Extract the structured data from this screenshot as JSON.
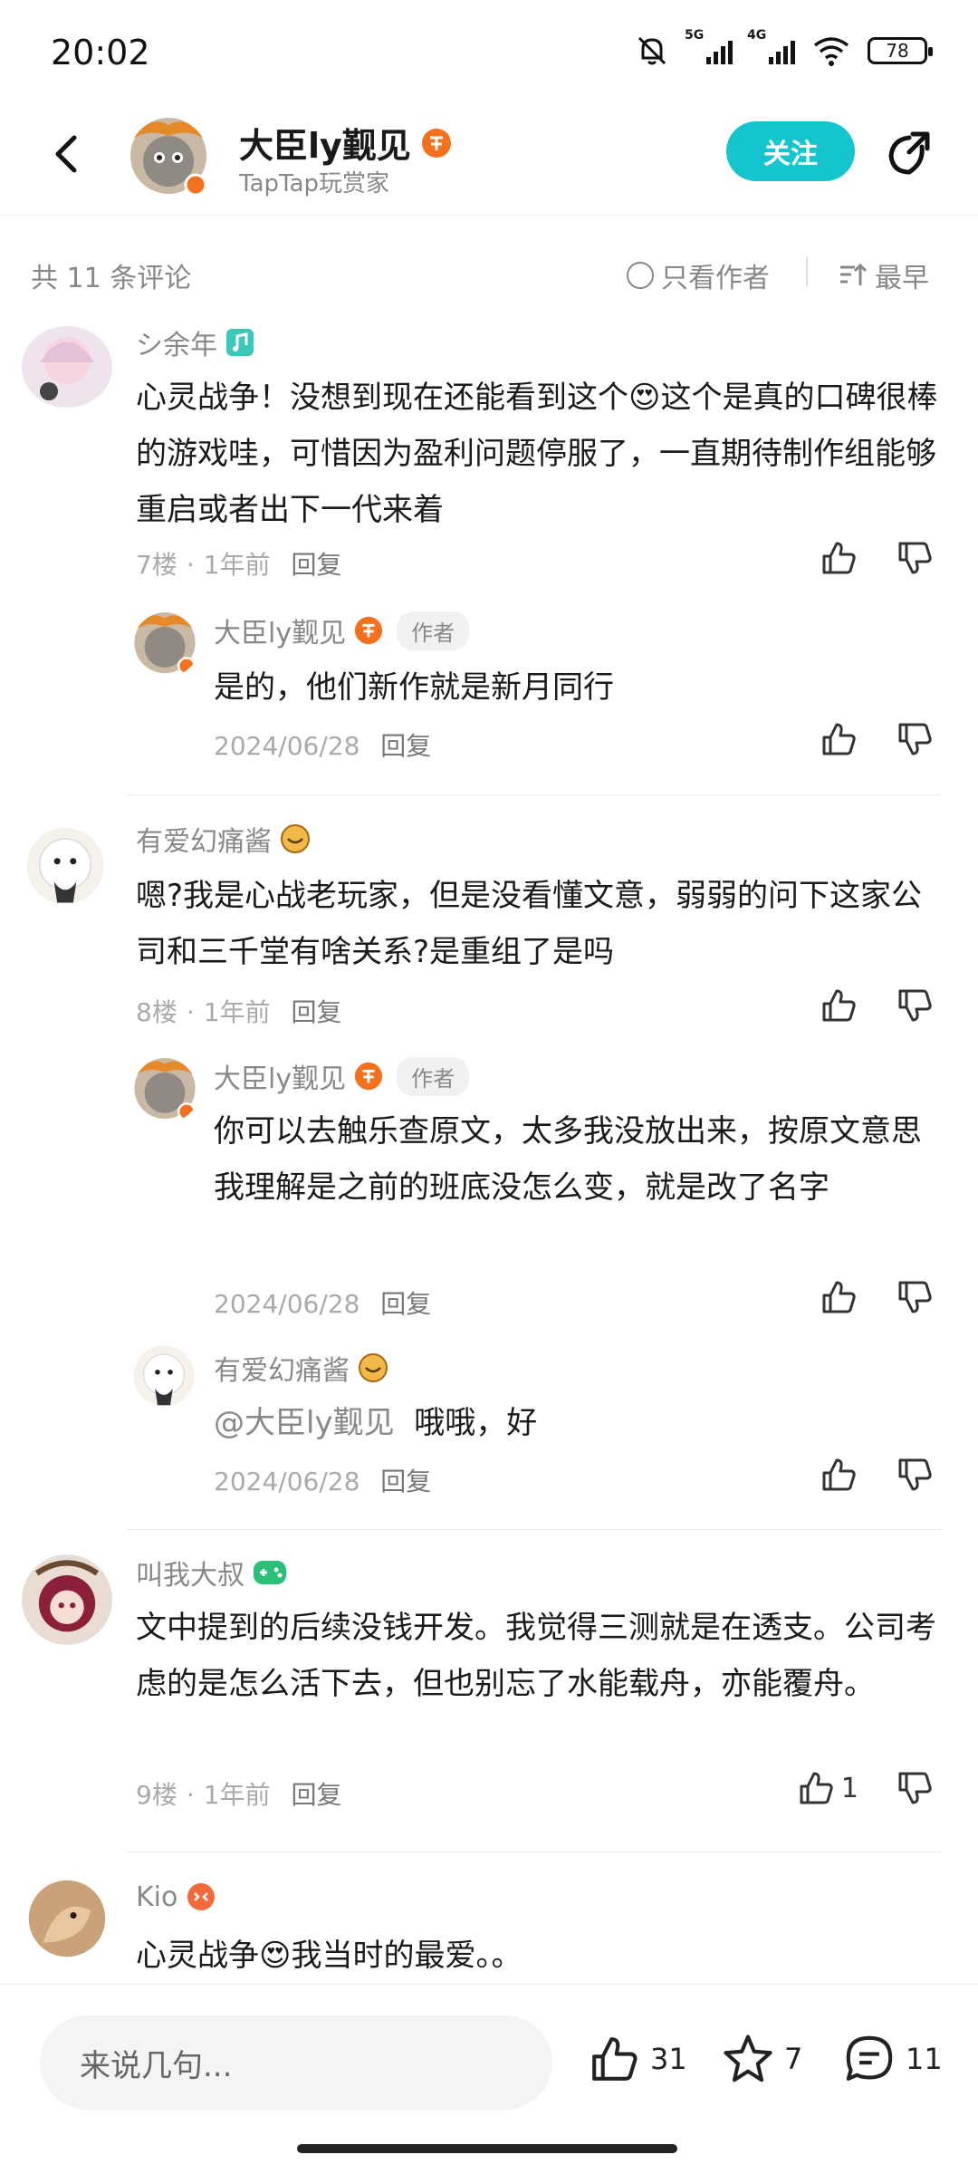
{
  "status_bar": {
    "time": "20:02",
    "net1": "5G",
    "net2": "4G",
    "battery": "78"
  },
  "header": {
    "user_name": "大臣ly觐见",
    "subtitle": "TapTap玩赏家",
    "follow_label": "关注"
  },
  "sort_bar": {
    "count": "共 11 条评论",
    "only_author": "只看作者",
    "sort_label": "最早"
  },
  "comments": [
    {
      "name": "シ余年",
      "text": "心灵战争！没想到现在还能看到这个😍这个是真的口碑很棒的游戏哇，可惜因为盈利问题停服了，一直期待制作组能够重启或者出下一代来着",
      "floor": "7楼",
      "time": "1年前",
      "reply": "回复",
      "like_count": ""
    },
    {
      "name": "有爱幻痛酱",
      "text": "嗯?我是心战老玩家，但是没看懂文意，弱弱的问下这家公司和三千堂有啥关系?是重组了是吗",
      "floor": "8楼",
      "time": "1年前",
      "reply": "回复",
      "like_count": ""
    },
    {
      "name": "叫我大叔",
      "text": "文中提到的后续没钱开发。我觉得三测就是在透支。公司考虑的是怎么活下去，但也别忘了水能载舟，亦能覆舟。",
      "floor": "9楼",
      "time": "1年前",
      "reply": "回复",
      "like_count": "1"
    },
    {
      "name": "Kio",
      "text": "心灵战争😍我当时的最爱。。"
    }
  ],
  "replies": [
    {
      "name": "大臣ly觐见",
      "tag": "作者",
      "text": "是的，他们新作就是新月同行",
      "date": "2024/06/28",
      "reply": "回复"
    },
    {
      "name": "大臣ly觐见",
      "tag": "作者",
      "text": "你可以去触乐查原文，太多我没放出来，按原文意思我理解是之前的班底没怎么变，就是改了名字",
      "date": "2024/06/28",
      "reply": "回复"
    },
    {
      "name": "有爱幻痛酱",
      "mention": "@大臣ly觐见",
      "text": "哦哦，好",
      "date": "2024/06/28",
      "reply": "回复"
    }
  ],
  "bottom_bar": {
    "input_placeholder": "来说几句...",
    "likes": "31",
    "favorites": "7",
    "comments": "11"
  },
  "colors": {
    "accent": "#15c5ce",
    "badge_orange": "#f2701e"
  },
  "icons": [
    "back-arrow-icon",
    "share-icon",
    "thumb-up-icon",
    "thumb-down-icon",
    "star-icon",
    "comment-icon",
    "radio-icon",
    "sort-icon"
  ]
}
